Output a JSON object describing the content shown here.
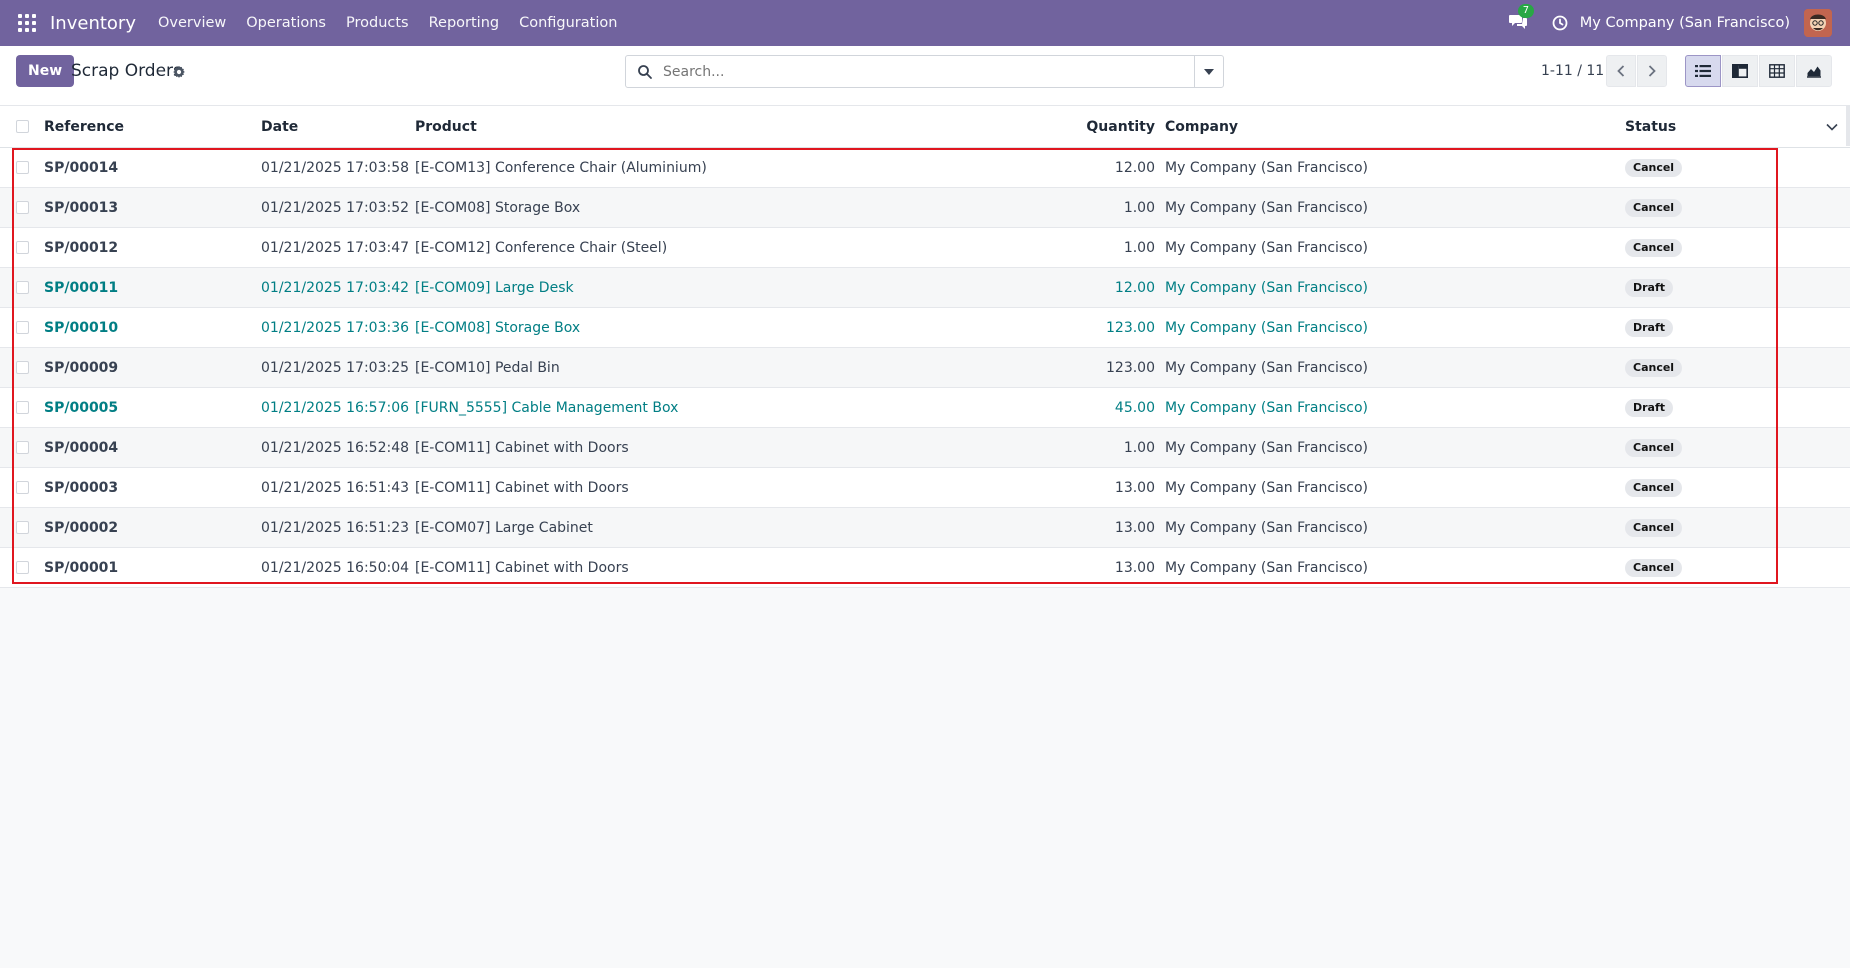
{
  "nav": {
    "brand": "Inventory",
    "menu": [
      "Overview",
      "Operations",
      "Products",
      "Reporting",
      "Configuration"
    ],
    "messages_count": "7",
    "company": "My Company (San Francisco)"
  },
  "control": {
    "new_label": "New",
    "title": "Scrap Orders",
    "search_placeholder": "Search...",
    "pager": "1-11 / 11"
  },
  "table": {
    "headers": {
      "reference": "Reference",
      "date": "Date",
      "product": "Product",
      "quantity": "Quantity",
      "company": "Company",
      "status": "Status"
    },
    "rows": [
      {
        "reference": "SP/00014",
        "date": "01/21/2025 17:03:58",
        "product": "[E-COM13] Conference Chair (Aluminium)",
        "quantity": "12.00",
        "company": "My Company (San Francisco)",
        "status": "Cancel"
      },
      {
        "reference": "SP/00013",
        "date": "01/21/2025 17:03:52",
        "product": "[E-COM08] Storage Box",
        "quantity": "1.00",
        "company": "My Company (San Francisco)",
        "status": "Cancel"
      },
      {
        "reference": "SP/00012",
        "date": "01/21/2025 17:03:47",
        "product": "[E-COM12] Conference Chair (Steel)",
        "quantity": "1.00",
        "company": "My Company (San Francisco)",
        "status": "Cancel"
      },
      {
        "reference": "SP/00011",
        "date": "01/21/2025 17:03:42",
        "product": "[E-COM09] Large Desk",
        "quantity": "12.00",
        "company": "My Company (San Francisco)",
        "status": "Draft"
      },
      {
        "reference": "SP/00010",
        "date": "01/21/2025 17:03:36",
        "product": "[E-COM08] Storage Box",
        "quantity": "123.00",
        "company": "My Company (San Francisco)",
        "status": "Draft"
      },
      {
        "reference": "SP/00009",
        "date": "01/21/2025 17:03:25",
        "product": "[E-COM10] Pedal Bin",
        "quantity": "123.00",
        "company": "My Company (San Francisco)",
        "status": "Cancel"
      },
      {
        "reference": "SP/00005",
        "date": "01/21/2025 16:57:06",
        "product": "[FURN_5555] Cable Management Box",
        "quantity": "45.00",
        "company": "My Company (San Francisco)",
        "status": "Draft"
      },
      {
        "reference": "SP/00004",
        "date": "01/21/2025 16:52:48",
        "product": "[E-COM11] Cabinet with Doors",
        "quantity": "1.00",
        "company": "My Company (San Francisco)",
        "status": "Cancel"
      },
      {
        "reference": "SP/00003",
        "date": "01/21/2025 16:51:43",
        "product": "[E-COM11] Cabinet with Doors",
        "quantity": "13.00",
        "company": "My Company (San Francisco)",
        "status": "Cancel"
      },
      {
        "reference": "SP/00002",
        "date": "01/21/2025 16:51:23",
        "product": "[E-COM07] Large Cabinet",
        "quantity": "13.00",
        "company": "My Company (San Francisco)",
        "status": "Cancel"
      },
      {
        "reference": "SP/00001",
        "date": "01/21/2025 16:50:04",
        "product": "[E-COM11] Cabinet with Doors",
        "quantity": "13.00",
        "company": "My Company (San Francisco)",
        "status": "Cancel"
      }
    ]
  },
  "colors": {
    "brand": "#71639e",
    "draft_link": "#017e84",
    "highlight": "#e0161f"
  },
  "icons": [
    "apps-grid-icon",
    "chat-icon",
    "clock-icon",
    "gear-icon",
    "search-icon",
    "caret-down-icon",
    "chevron-left-icon",
    "chevron-right-icon",
    "list-view-icon",
    "kanban-view-icon",
    "pivot-view-icon",
    "graph-view-icon",
    "optional-columns-icon"
  ]
}
